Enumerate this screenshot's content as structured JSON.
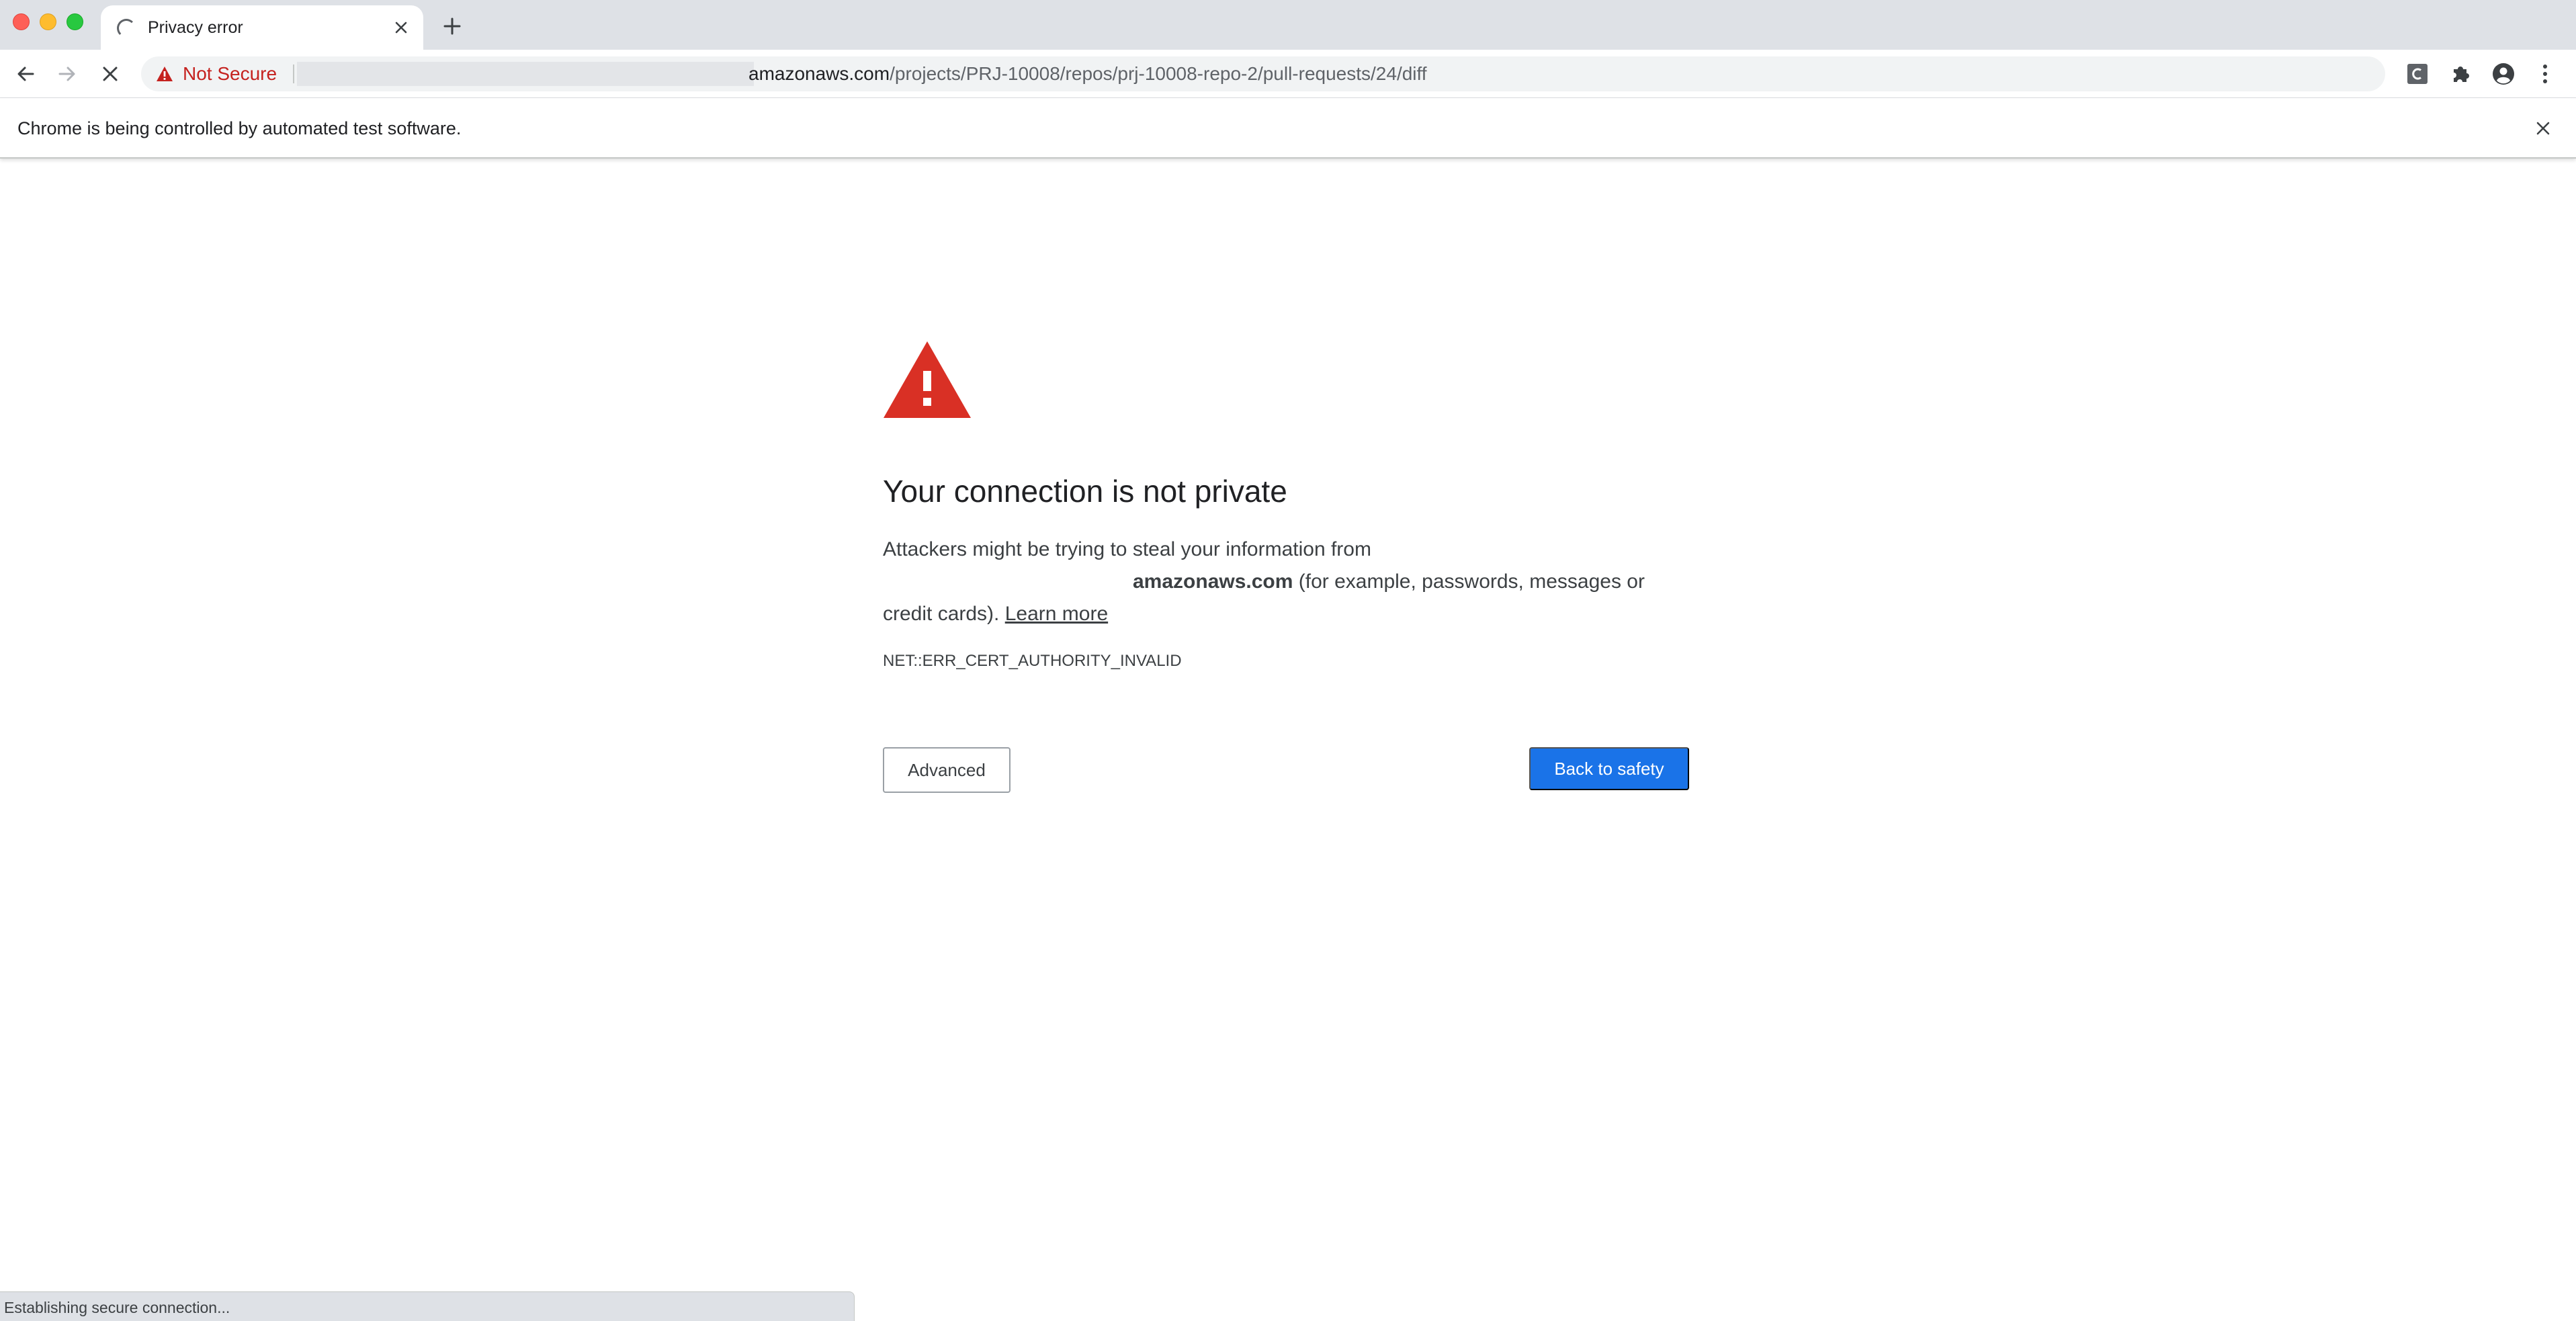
{
  "tab": {
    "title": "Privacy error"
  },
  "omnibox": {
    "security_label": "Not Secure",
    "url_host": "amazonaws.com",
    "url_path": "/projects/PRJ-10008/repos/prj-10008-repo-2/pull-requests/24/diff"
  },
  "infobar": {
    "message": "Chrome is being controlled by automated test software."
  },
  "interstitial": {
    "heading": "Your connection is not private",
    "body_line1": "Attackers might be trying to steal your information from",
    "body_host": "amazonaws.com",
    "body_line2_rest": " (for example, passwords, messages or",
    "body_line3": "credit cards). ",
    "learn_more": "Learn more",
    "error_code": "NET::ERR_CERT_AUTHORITY_INVALID",
    "advanced_label": "Advanced",
    "back_label": "Back to safety"
  },
  "status": {
    "text": "Establishing secure connection..."
  },
  "colors": {
    "accent": "#1a73e8",
    "warning_red": "#d93025",
    "not_secure_red": "#c5221f",
    "tabstrip": "#dee1e6"
  },
  "icons": {
    "tab_loading": "loading-spinner-icon",
    "back": "back-arrow-icon",
    "forward": "forward-arrow-icon",
    "stop": "stop-icon",
    "warning": "warning-triangle-icon",
    "bookmark": "star-icon",
    "extension_c": "extension-c-icon",
    "extensions": "puzzle-icon",
    "profile": "profile-icon",
    "menu": "kebab-menu-icon"
  }
}
